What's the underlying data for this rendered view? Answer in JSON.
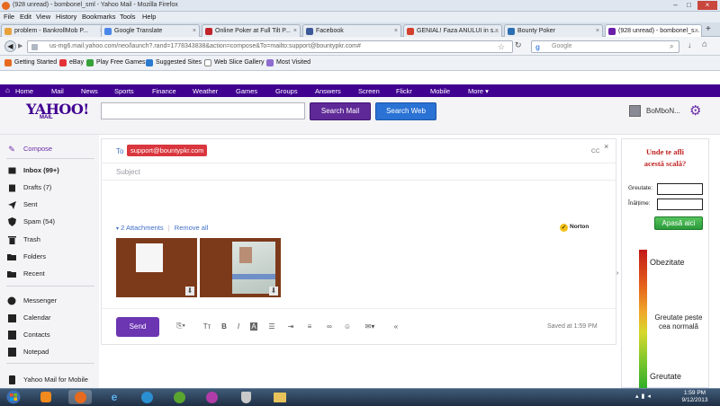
{
  "window": {
    "title": "(928 unread) - bombonel_sml - Yahoo Mail - Mozilla Firefox"
  },
  "menu": [
    "File",
    "Edit",
    "View",
    "History",
    "Bookmarks",
    "Tools",
    "Help"
  ],
  "tabs": [
    {
      "label": "problem - BankrollMob P...",
      "color": "#e8a23c"
    },
    {
      "label": "Google Translate",
      "color": "#4a86e8"
    },
    {
      "label": "Online Poker at Full Tilt P...",
      "color": "#c0242b"
    },
    {
      "label": "Facebook",
      "color": "#3b5998"
    },
    {
      "label": "GENIAL! Faza ANULUI in s...",
      "color": "#d53f2e"
    },
    {
      "label": "Bounty Poker",
      "color": "#2b6fb0"
    },
    {
      "label": "(928 unread) - bombonel_s...",
      "color": "#6a1fa8"
    }
  ],
  "nav": {
    "url": "us-mg6.mail.yahoo.com/neo/launch?.rand=1778343838&action=compose&To=mailto:support@bountypkr.com#",
    "search_placeholder": "Google"
  },
  "bookmarks": [
    "Getting Started",
    "eBay",
    "Play Free Games",
    "Suggested Sites",
    "Web Slice Gallery",
    "Most Visited"
  ],
  "ynav": [
    "Home",
    "Mail",
    "News",
    "Sports",
    "Finance",
    "Weather",
    "Games",
    "Groups",
    "Answers",
    "Screen",
    "Flickr",
    "Mobile",
    "More ▾"
  ],
  "header": {
    "logo": "YAHOO!",
    "logo_sub": "MAIL",
    "search_mail": "Search Mail",
    "search_web": "Search Web",
    "user": "BoMboN..."
  },
  "sidebar": {
    "compose": "Compose",
    "folders": [
      {
        "label": "Inbox (99+)",
        "bold": true
      },
      {
        "label": "Drafts (7)"
      },
      {
        "label": "Sent"
      },
      {
        "label": "Spam (54)"
      },
      {
        "label": "Trash"
      },
      {
        "label": "Folders"
      },
      {
        "label": "Recent"
      }
    ],
    "apps": [
      "Messenger",
      "Calendar",
      "Contacts",
      "Notepad"
    ],
    "mobile": "Yahoo Mail for Mobile"
  },
  "compose": {
    "to_label": "To",
    "recipient": "support@bountypkr.com",
    "cc": "CC",
    "subject_placeholder": "Subject",
    "attachments": "2 Attachments",
    "remove_all": "Remove all",
    "norton": "Norton",
    "send": "Send",
    "saved": "Saved at 1:59 PM"
  },
  "ad": {
    "title_line1": "Unde te afli",
    "title_line2": "acestă scală?",
    "weight_label": "Greutate:",
    "height_label": "Înălțime:",
    "button": "Apasă aici",
    "level1": "Obezitate",
    "level2": "Greutate peste cea normală",
    "level3": "Greutate"
  },
  "clock": {
    "time": "1:59 PM",
    "date": "9/12/2013"
  }
}
